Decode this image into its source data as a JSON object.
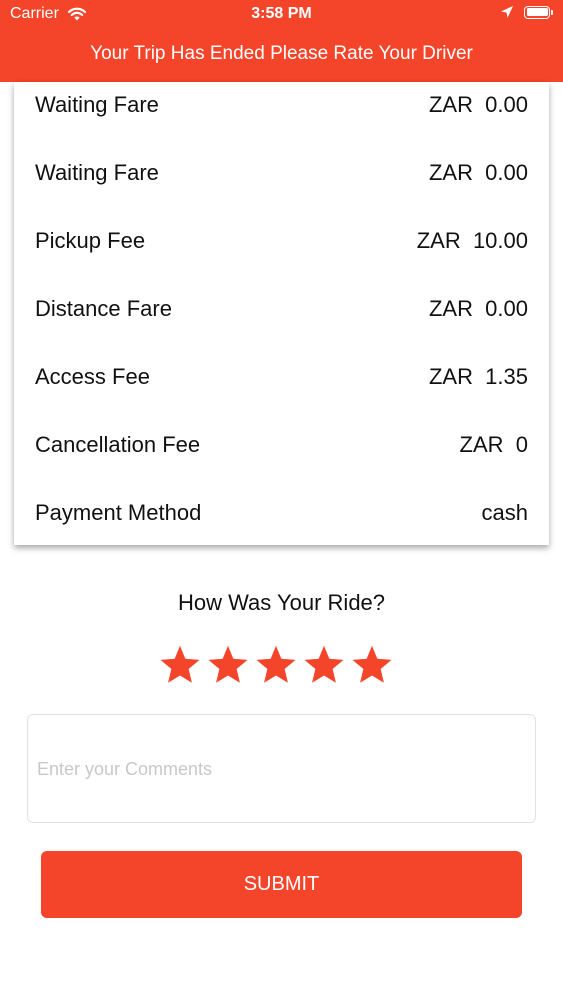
{
  "status_bar": {
    "carrier": "Carrier",
    "time": "3:58 PM"
  },
  "header": {
    "title": "Your Trip Has Ended Please Rate Your Driver",
    "color": "#f4442a"
  },
  "fares": [
    {
      "label": "Waiting Fare",
      "value": "ZAR  0.00"
    },
    {
      "label": "Waiting Fare",
      "value": "ZAR  0.00"
    },
    {
      "label": "Pickup Fee",
      "value": "ZAR  10.00"
    },
    {
      "label": "Distance Fare",
      "value": "ZAR  0.00"
    },
    {
      "label": "Access Fee",
      "value": "ZAR  1.35"
    },
    {
      "label": "Cancellation Fee",
      "value": "ZAR  0"
    },
    {
      "label": "Payment Method",
      "value": "cash"
    }
  ],
  "rating": {
    "title": "How Was Your Ride?",
    "stars_filled": 5,
    "stars_total": 5,
    "star_color": "#f4442a"
  },
  "comments": {
    "placeholder": "Enter your Comments",
    "value": ""
  },
  "submit": {
    "label": "SUBMIT"
  }
}
